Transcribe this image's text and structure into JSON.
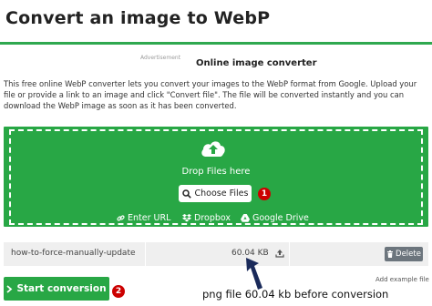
{
  "header": {
    "title": "Convert an image to WebP"
  },
  "advertisement_label": "Advertisement",
  "section": {
    "heading": "Online image converter",
    "intro": "This free online WebP converter lets you convert your images to the WebP format from Google. Upload your file or provide a link to an image and click \"Convert file\". The file will be converted instantly and you can download the WebP image as soon as it has been converted."
  },
  "dropzone": {
    "drop_text": "Drop Files here",
    "choose_label": "Choose Files",
    "choose_badge": "1",
    "sources": [
      {
        "label": "Enter URL",
        "icon": "link-icon"
      },
      {
        "label": "Dropbox",
        "icon": "dropbox-icon"
      },
      {
        "label": "Google Drive",
        "icon": "google-drive-icon"
      }
    ],
    "colors": {
      "background": "#28a745",
      "text": "#ffffff"
    }
  },
  "file": {
    "name": "how-to-force-manually-update",
    "size": "60.04 KB",
    "delete_label": "Delete"
  },
  "actions": {
    "start_label": "Start conversion",
    "start_badge": "2",
    "add_example_label": "Add example file"
  },
  "annotation": {
    "text": "png file 60.04 kb before conversion"
  },
  "colors": {
    "accent": "#28a745",
    "badge": "#cc0000",
    "delete": "#6c757d"
  }
}
